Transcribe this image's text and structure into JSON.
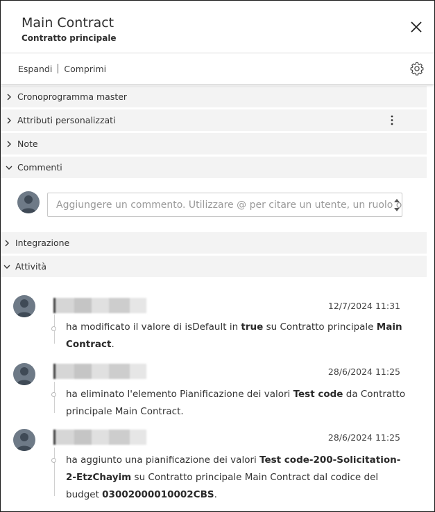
{
  "panel": {
    "title": "Main Contract",
    "subtitle": "Contratto principale"
  },
  "toolbar": {
    "expand_label": "Espandi",
    "collapse_label": "Comprimi"
  },
  "sections": {
    "master_schedule": "Cronoprogramma master",
    "custom_attributes": "Attributi personalizzati",
    "notes": "Note",
    "comments": "Commenti",
    "integration": "Integrazione",
    "activity": "Attività"
  },
  "comment_input": {
    "placeholder": "Aggiungere un commento. Utilizzare @ per citare un utente, un ruolo o un'azienda."
  },
  "activities": [
    {
      "date": "12/7/2024 11:31",
      "t1": "ha modificato il valore di isDefault in ",
      "b1": "true",
      "t2": " su Contratto principale ",
      "b2": "Main Contract",
      "t3": "."
    },
    {
      "date": "28/6/2024 11:25",
      "t1": "ha eliminato l'elemento Pianificazione dei valori ",
      "b1": "Test code",
      "t2": " da Contratto principale Main Contract."
    },
    {
      "date": "28/6/2024 11:25",
      "t1": "ha aggiunto una pianificazione dei valori ",
      "b1": "Test code-200-Solicitation-2-EtzChayim",
      "t2": " su Contratto principale Main Contract dal codice del budget ",
      "b2": "03002000010002CBS",
      "t3": "."
    }
  ],
  "colors": {
    "section_bg": "#f3f3f3",
    "avatar_bg": "#6e7a87",
    "text": "#2c2c2c"
  }
}
